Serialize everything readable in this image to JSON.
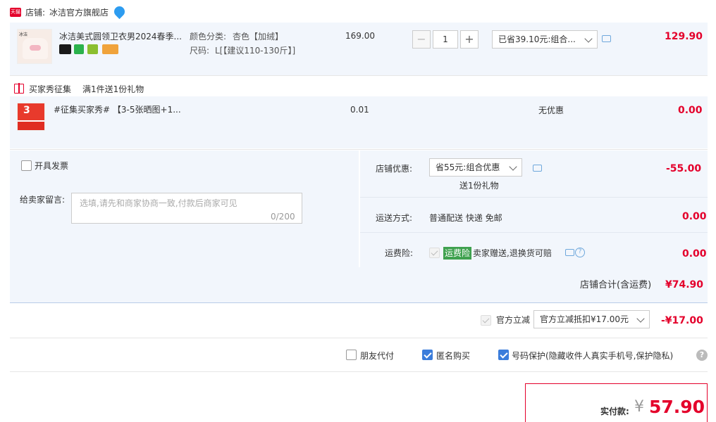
{
  "shop": {
    "badge": "天猫",
    "label": "店铺:",
    "name": "冰洁官方旗舰店"
  },
  "item1": {
    "title": "冰洁美式圆领卫衣男2024春季...",
    "color_label": "颜色分类:",
    "color_value": "杏色【加绒】",
    "size_label": "尺码:",
    "size_value": "L[【建议110-130斤】]",
    "unit_price": "169.00",
    "qty_minus": "−",
    "qty": "1",
    "qty_plus": "+",
    "promo": "已省39.10元:组合...",
    "subtotal": "129.90",
    "badges": [
      "new-badge",
      "7-day-return-badge",
      "shield-badge",
      "card-badge"
    ]
  },
  "gift_section": {
    "title": "买家秀征集",
    "rule": "满1件送1份礼物"
  },
  "item2": {
    "title": "#征集买家秀# 【3-5张晒图+1...",
    "unit_price": "0.01",
    "promo": "无优惠",
    "subtotal": "0.00",
    "thumb_num": "3"
  },
  "invoice": {
    "label": "开具发票"
  },
  "message": {
    "label": "给卖家留言:",
    "placeholder": "选填,请先和商家协商一致,付款后商家可见",
    "counter": "0/200"
  },
  "shop_discount": {
    "label": "店铺优惠:",
    "select": "省55元:组合优惠",
    "note": "送1份礼物",
    "amount": "-55.00"
  },
  "shipping": {
    "label": "运送方式:",
    "value": "普通配送 快递 免邮",
    "amount": "0.00"
  },
  "insurance": {
    "label": "运费险:",
    "tag": "运费险",
    "text": "卖家赠送,退换货可赔",
    "amount": "0.00"
  },
  "shop_total": {
    "label": "店铺合计(含运费)",
    "amount": "¥74.90"
  },
  "official": {
    "label": "官方立减",
    "select": "官方立减抵扣¥17.00元",
    "amount": "-¥17.00"
  },
  "options": {
    "friend_pay": "朋友代付",
    "anonymous": "匿名购买",
    "privacy": "号码保护(隐藏收件人真实手机号,保护隐私)",
    "help": "?"
  },
  "payment": {
    "label": "实付款:",
    "currency": "¥",
    "amount": "57.90"
  },
  "colors": {
    "accent_red": "#e4002b",
    "panel_bg": "#f2f6fc",
    "check_blue": "#3b7ddb",
    "insurance_green": "#3fa14f"
  }
}
